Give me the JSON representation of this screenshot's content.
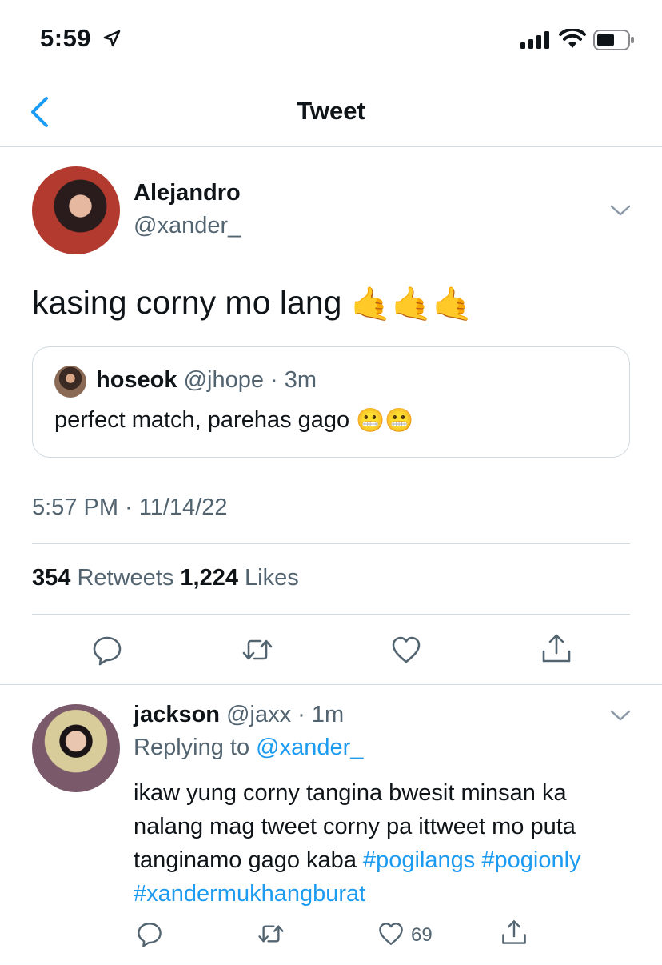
{
  "status_bar": {
    "time": "5:59"
  },
  "nav": {
    "title": "Tweet"
  },
  "tweet": {
    "author_name": "Alejandro",
    "author_handle": "@xander_",
    "text": "kasing corny mo lang",
    "emoji": "🤙🤙🤙",
    "quote": {
      "author_name": "hoseok",
      "author_handle": "@jhope",
      "separator": " · ",
      "age": "3m",
      "text": "perfect match, parehas gago",
      "emoji": "😬😬"
    },
    "timestamp": "5:57 PM · 11/14/22",
    "retweets_count": "354",
    "retweets_label": "Retweets",
    "likes_count": "1,224",
    "likes_label": "Likes"
  },
  "reply": {
    "author_name": "jackson",
    "author_handle": "@jaxx",
    "separator": " · ",
    "age": "1m",
    "replying_label": "Replying to",
    "replying_to": "@xander_",
    "text": "ikaw yung corny tangina bwesit minsan ka nalang mag tweet corny pa ittweet mo puta tanginamo gago kaba",
    "hashtags": [
      "#pogilangs",
      "#pogionly",
      "#xandermukhangburat"
    ],
    "like_count": "69"
  },
  "colors": {
    "accent": "#1d9bf0",
    "muted": "#536471",
    "divider": "#cfd9de"
  },
  "icons": [
    "location-arrow-icon",
    "signal-icon",
    "wifi-icon",
    "battery-icon",
    "back-chevron-icon",
    "chevron-down-icon",
    "reply-icon",
    "retweet-icon",
    "like-icon",
    "share-icon"
  ]
}
